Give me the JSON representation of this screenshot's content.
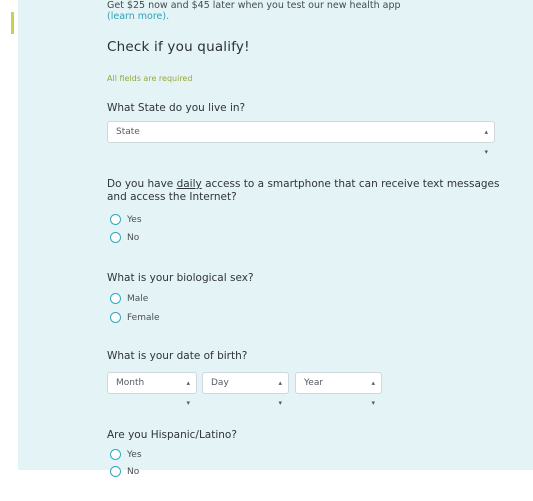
{
  "intro": {
    "text": "Get $25 now and $45 later when you test our new health app",
    "link": "(learn more)."
  },
  "heading": "Check if you qualify!",
  "required_note": "All fields are required",
  "state": {
    "question": "What State do you live in?",
    "select_value": "State"
  },
  "smartphone": {
    "question_prefix": "Do you have ",
    "question_emphasis": "daily",
    "question_suffix": " access to a smartphone that can receive text messages and access the Internet?",
    "options": [
      "Yes",
      "No"
    ]
  },
  "sex": {
    "question": "What is your biological sex?",
    "options": [
      "Male",
      "Female"
    ]
  },
  "dob": {
    "question": "What is your date of birth?",
    "month": "Month",
    "day": "Day",
    "year": "Year"
  },
  "hispanic": {
    "question": "Are you Hispanic/Latino?",
    "options": [
      "Yes",
      "No"
    ]
  },
  "colors": {
    "panel_background": "#e3f3f6",
    "accent": "#2fa9bf",
    "required_text": "#97a93a"
  }
}
